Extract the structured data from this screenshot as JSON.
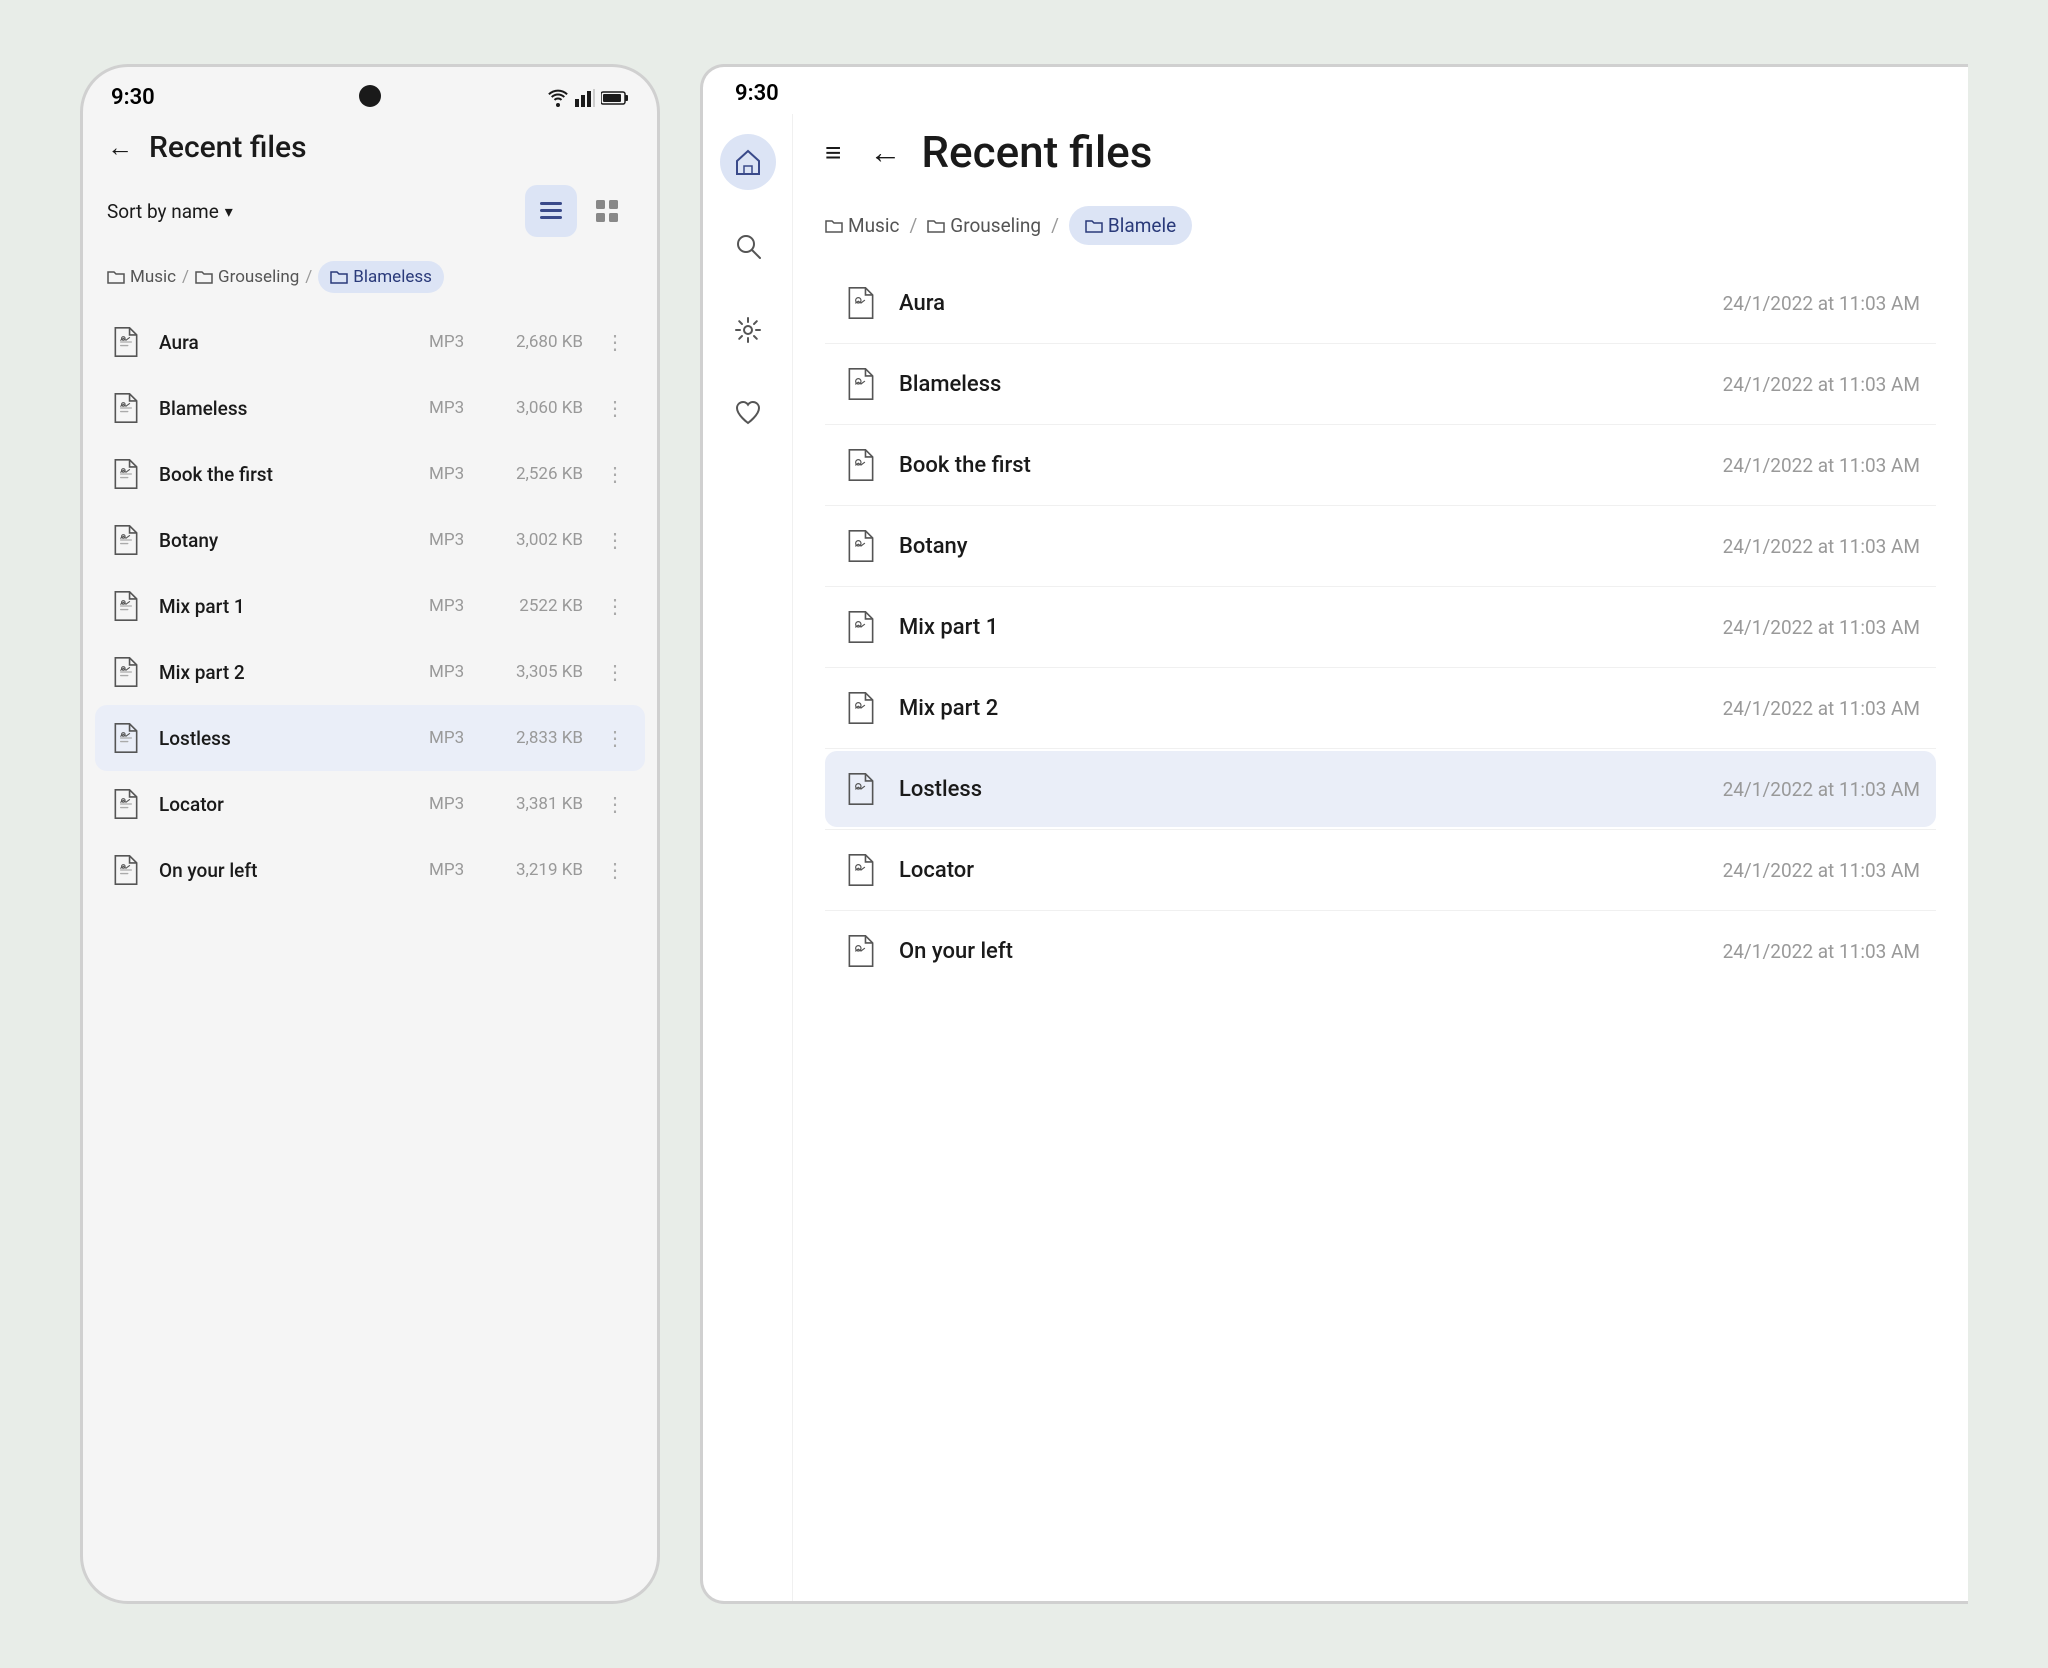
{
  "colors": {
    "accent": "#dce4f5",
    "accentText": "#2a3a7a",
    "background": "#e8ede8",
    "phoneBg": "#f5f5f5",
    "tabletBg": "#ffffff",
    "text": "#1a1a1a",
    "muted": "#999999",
    "separator": "#f0f0f0"
  },
  "phone": {
    "statusBar": {
      "time": "9:30",
      "wifiIcon": "wifi-icon",
      "signalIcon": "signal-icon",
      "batteryIcon": "battery-icon"
    },
    "header": {
      "backLabel": "←",
      "title": "Recent files"
    },
    "sortBar": {
      "sortLabel": "Sort by name",
      "chevron": "▾"
    },
    "viewToggle": {
      "listLabel": "≡",
      "gridLabel": "⊞",
      "activeView": "list"
    },
    "breadcrumb": [
      {
        "icon": "folder-icon",
        "label": "Music"
      },
      {
        "sep": "/"
      },
      {
        "icon": "folder-icon",
        "label": "Grouseling"
      },
      {
        "sep": "/"
      },
      {
        "icon": "folder-icon",
        "label": "Blameless",
        "active": true
      }
    ],
    "files": [
      {
        "name": "Aura",
        "type": "MP3",
        "size": "2,680 KB",
        "selected": false
      },
      {
        "name": "Blameless",
        "type": "MP3",
        "size": "3,060 KB",
        "selected": false
      },
      {
        "name": "Book the first",
        "type": "MP3",
        "size": "2,526 KB",
        "selected": false
      },
      {
        "name": "Botany",
        "type": "MP3",
        "size": "3,002 KB",
        "selected": false
      },
      {
        "name": "Mix part 1",
        "type": "MP3",
        "size": "2522 KB",
        "selected": false
      },
      {
        "name": "Mix part 2",
        "type": "MP3",
        "size": "3,305 KB",
        "selected": false
      },
      {
        "name": "Lostless",
        "type": "MP3",
        "size": "2,833 KB",
        "selected": true
      },
      {
        "name": "Locator",
        "type": "MP3",
        "size": "3,381 KB",
        "selected": false
      },
      {
        "name": "On your left",
        "type": "MP3",
        "size": "3,219 KB",
        "selected": false
      }
    ]
  },
  "tablet": {
    "statusBar": {
      "time": "9:30"
    },
    "sidebar": {
      "icons": [
        {
          "name": "home-icon",
          "symbol": "⌂",
          "active": true
        },
        {
          "name": "search-icon",
          "symbol": "🔍",
          "active": false
        },
        {
          "name": "settings-icon",
          "symbol": "⚙",
          "active": false
        },
        {
          "name": "favorites-icon",
          "symbol": "♡",
          "active": false
        }
      ]
    },
    "header": {
      "hamburgerLabel": "≡",
      "backLabel": "←",
      "title": "Recent files"
    },
    "breadcrumb": [
      {
        "icon": "folder-icon",
        "label": "Music"
      },
      {
        "sep": "/"
      },
      {
        "icon": "folder-icon",
        "label": "Grouseling"
      },
      {
        "sep": "/"
      },
      {
        "icon": "folder-icon",
        "label": "Blamele",
        "active": true
      }
    ],
    "files": [
      {
        "name": "Aura",
        "date": "24/1/2022 at 11:03 AM",
        "selected": false
      },
      {
        "name": "Blameless",
        "date": "24/1/2022 at 11:03 AM",
        "selected": false
      },
      {
        "name": "Book the first",
        "date": "24/1/2022 at 11:03 AM",
        "selected": false
      },
      {
        "name": "Botany",
        "date": "24/1/2022 at 11:03 AM",
        "selected": false
      },
      {
        "name": "Mix part 1",
        "date": "24/1/2022 at 11:03 AM",
        "selected": false
      },
      {
        "name": "Mix part 2",
        "date": "24/1/2022 at 11:03 AM",
        "selected": false
      },
      {
        "name": "Lostless",
        "date": "24/1/2022 at 11:03 AM",
        "selected": true
      },
      {
        "name": "Locator",
        "date": "24/1/2022 at 11:03 AM",
        "selected": false
      },
      {
        "name": "On your left",
        "date": "24/1/2022 at 11:03 AM",
        "selected": false
      }
    ]
  }
}
